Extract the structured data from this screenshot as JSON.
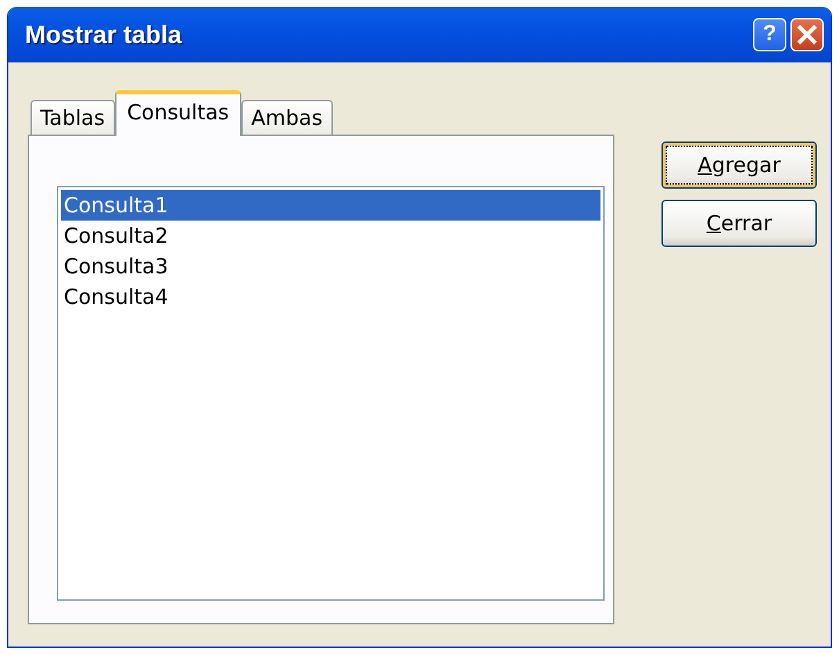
{
  "window": {
    "title": "Mostrar tabla",
    "help_button": "?"
  },
  "tabs": [
    {
      "label": "Tablas",
      "selected": false
    },
    {
      "label": "Consultas",
      "selected": true
    },
    {
      "label": "Ambas",
      "selected": false
    }
  ],
  "list": [
    {
      "label": "Consulta1",
      "selected": true
    },
    {
      "label": "Consulta2",
      "selected": false
    },
    {
      "label": "Consulta3",
      "selected": false
    },
    {
      "label": "Consulta4",
      "selected": false
    }
  ],
  "buttons": [
    {
      "label": "Agregar",
      "default": true
    },
    {
      "label": "Cerrar",
      "default": false
    }
  ]
}
